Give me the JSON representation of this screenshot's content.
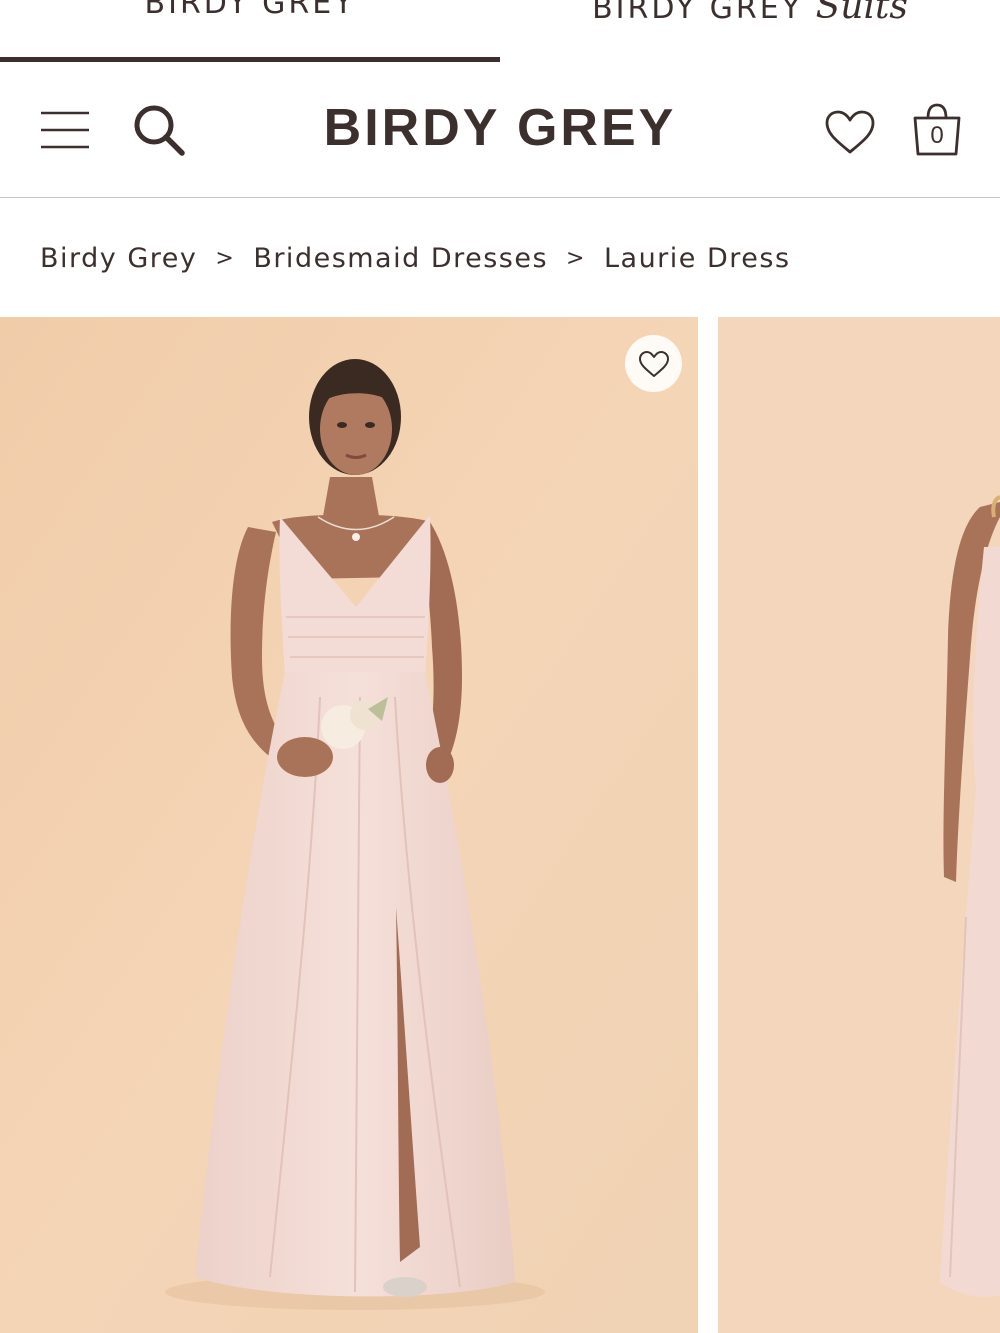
{
  "brand_tabs": [
    {
      "label": "BIRDY GREY",
      "script": "",
      "active": true
    },
    {
      "label": "BIRDY GREY ",
      "script": "Suits",
      "active": false
    }
  ],
  "header": {
    "logo": "BIRDY GREY",
    "cart_count": "0",
    "icons": [
      "menu-icon",
      "search-icon",
      "heart-icon",
      "shopping-bag-icon"
    ]
  },
  "breadcrumb": {
    "items": [
      "Birdy Grey",
      "Bridesmaid Dresses",
      "Laurie Dress"
    ],
    "separator": ">"
  },
  "gallery": {
    "slides": 2,
    "favorite_icon": "heart-icon",
    "colors": {
      "background": "#f3d3b3",
      "dress": "#f2d9d2",
      "skin": "#a9735a",
      "hair": "#3a2a22"
    }
  },
  "colors": {
    "text": "#3b302d",
    "divider": "#c9c4c1"
  }
}
